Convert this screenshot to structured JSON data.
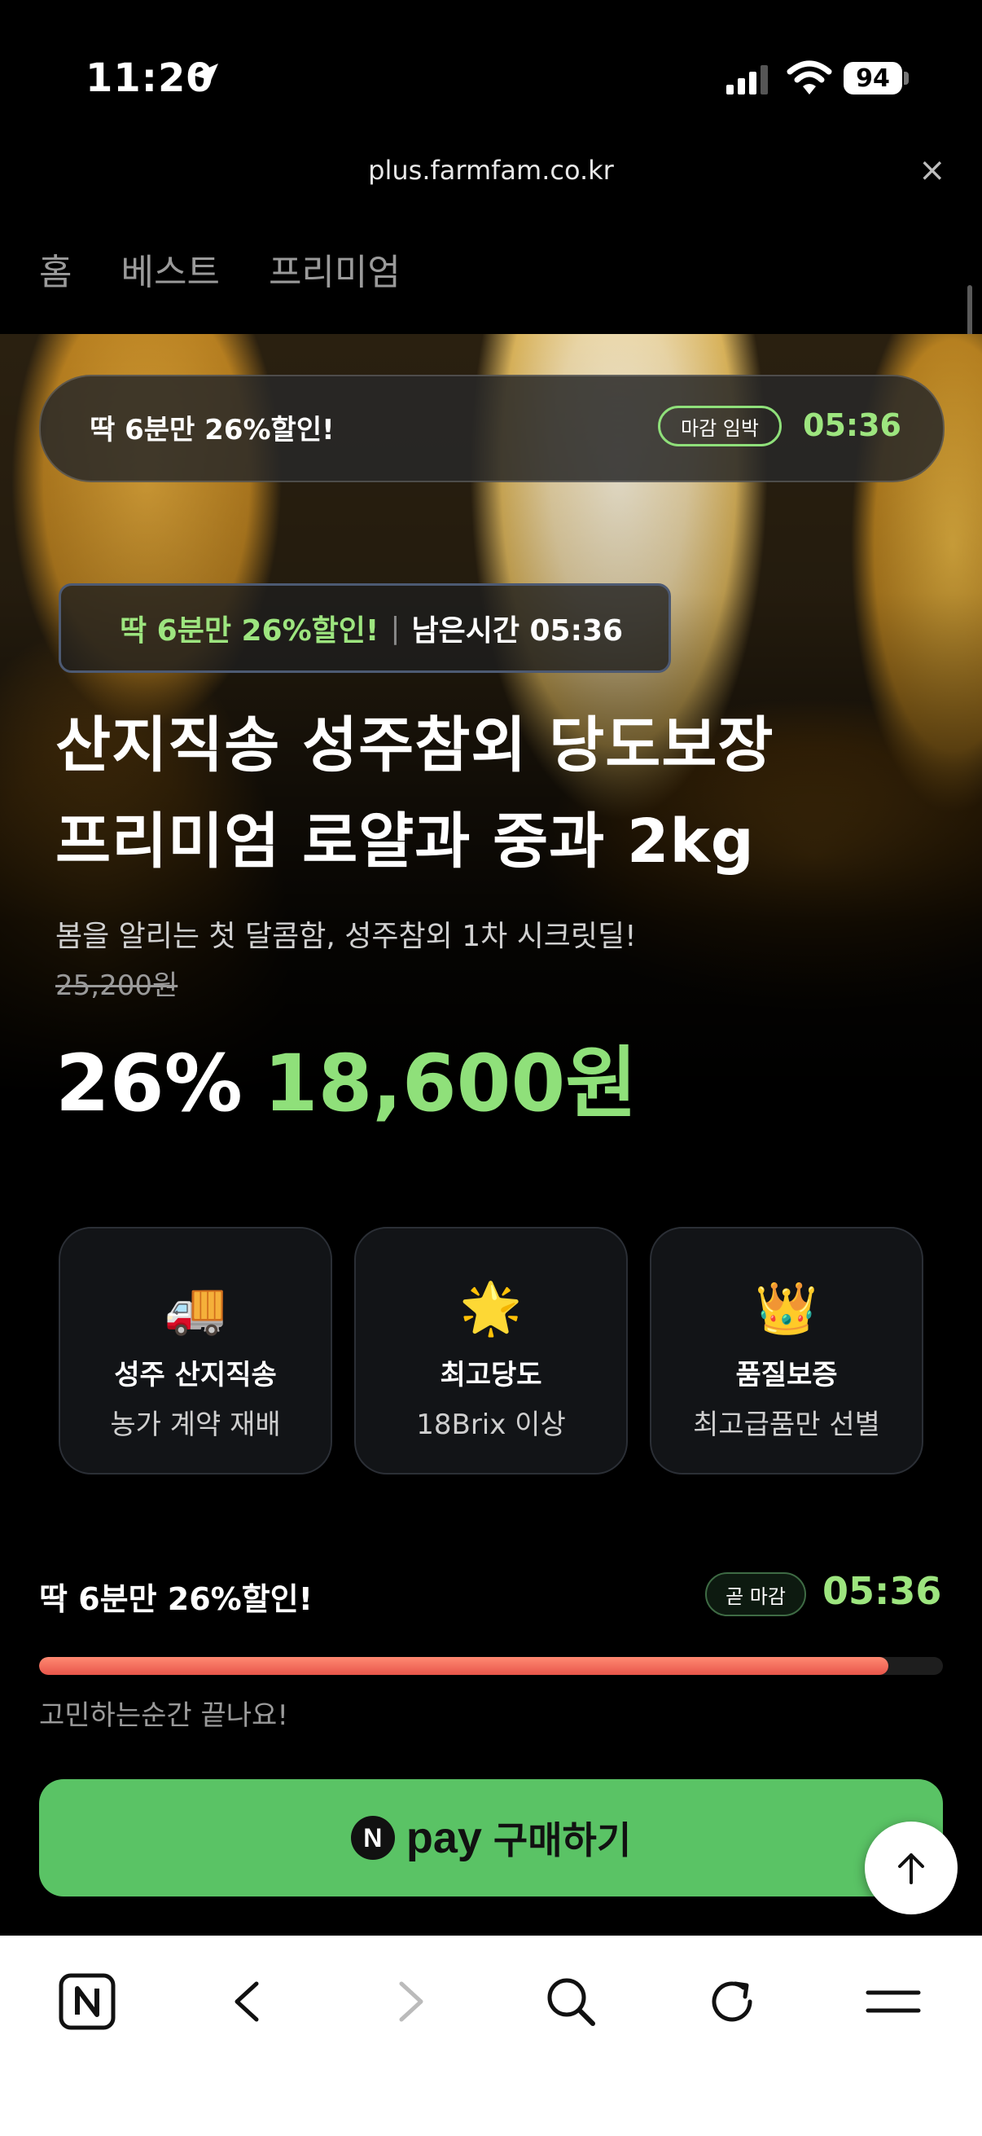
{
  "status": {
    "time": "11:20",
    "battery": "94"
  },
  "browser": {
    "url": "plus.farmfam.co.kr",
    "close": "×"
  },
  "tabs": [
    "홈",
    "베스트",
    "프리미엄"
  ],
  "timer_bar": {
    "text": "딱 6분만 26%할인!",
    "pill": "마감 임박",
    "countdown": "05:36"
  },
  "badge": {
    "promo": "딱 6분만 26%할인!",
    "separator": "|",
    "remaining": "남은시간 05:36"
  },
  "product": {
    "title_line1": "산지직송 성주참외 당도보장",
    "title_line2": "프리미엄 로얄과 중과 2kg",
    "subtitle": "봄을 알리는 첫 달콤함, 성주참외 1차 시크릿딜!",
    "original_price": "25,200원",
    "discount": "26%",
    "price": "18,600원"
  },
  "features": [
    {
      "icon": "🚚",
      "title": "성주 산지직송",
      "desc": "농가 계약 재배"
    },
    {
      "icon": "🌟",
      "title": "최고당도",
      "desc": "18Brix 이상"
    },
    {
      "icon": "👑",
      "title": "품질보증",
      "desc": "최고급품만 선별"
    }
  ],
  "deal": {
    "title": "딱 6분만 26%할인!",
    "pill": "곧 마감",
    "countdown": "05:36",
    "progress": 0.94,
    "hint": "고민하는순간 끝나요!"
  },
  "buy": {
    "npay_n": "N",
    "npay": "pay",
    "label": "구매하기"
  },
  "colors": {
    "accent_green": "#8fe07a",
    "button_green": "#5ac365",
    "progress_red": "#e8554a"
  }
}
